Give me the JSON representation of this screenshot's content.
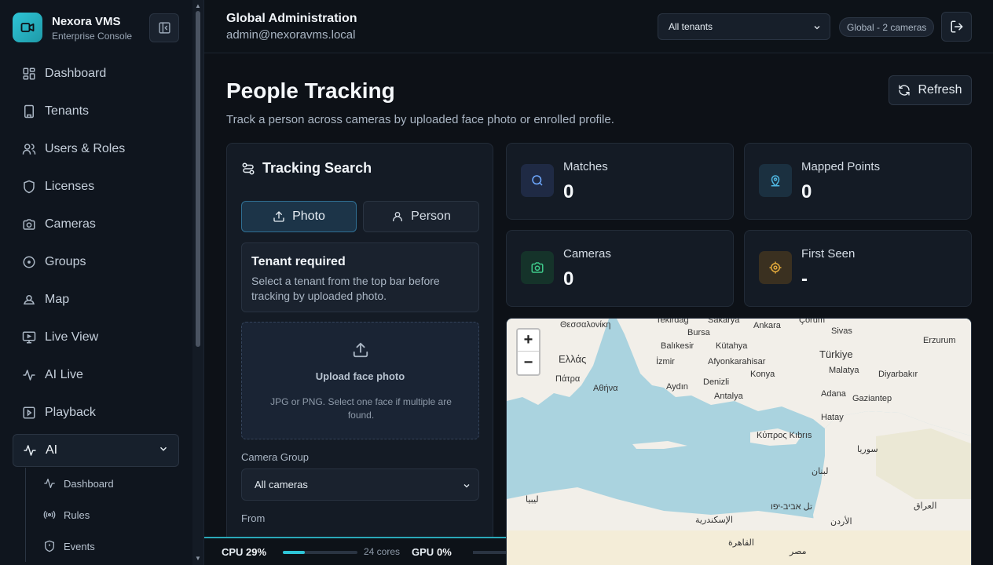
{
  "brand": {
    "title": "Nexora VMS",
    "subtitle": "Enterprise Console"
  },
  "nav": [
    {
      "label": "Dashboard",
      "icon": "dashboard-icon"
    },
    {
      "label": "Tenants",
      "icon": "building-icon"
    },
    {
      "label": "Users & Roles",
      "icon": "users-icon"
    },
    {
      "label": "Licenses",
      "icon": "shield-icon"
    },
    {
      "label": "Cameras",
      "icon": "camera-icon"
    },
    {
      "label": "Groups",
      "icon": "target-icon"
    },
    {
      "label": "Map",
      "icon": "map-pin-icon"
    },
    {
      "label": "Live View",
      "icon": "monitor-icon"
    },
    {
      "label": "AI Live",
      "icon": "pulse-icon"
    },
    {
      "label": "Playback",
      "icon": "play-icon"
    },
    {
      "label": "AI",
      "icon": "pulse-icon",
      "active": true
    }
  ],
  "subnav": [
    {
      "label": "Dashboard",
      "icon": "pulse-icon"
    },
    {
      "label": "Rules",
      "icon": "broadcast-icon"
    },
    {
      "label": "Events",
      "icon": "shield-icon"
    }
  ],
  "header": {
    "title": "Global Administration",
    "user": "admin@nexoravms.local",
    "tenant_select": "All tenants",
    "badge": "Global - 2 cameras"
  },
  "page": {
    "title": "People Tracking",
    "subtitle": "Track a person across cameras by uploaded face photo or enrolled profile.",
    "refresh_label": "Refresh"
  },
  "search": {
    "title": "Tracking Search",
    "tab_photo": "Photo",
    "tab_person": "Person",
    "notice_title": "Tenant required",
    "notice_text": "Select a tenant from the top bar before tracking by uploaded photo.",
    "upload_title": "Upload face photo",
    "upload_text": "JPG or PNG. Select one face if multiple are found.",
    "camera_group_label": "Camera Group",
    "camera_group_value": "All cameras",
    "from_label": "From"
  },
  "stats": [
    {
      "label": "Matches",
      "value": "0",
      "color": "#6ea8fe"
    },
    {
      "label": "Mapped Points",
      "value": "0",
      "color": "#4fb6e0"
    },
    {
      "label": "Cameras",
      "value": "0",
      "color": "#3ec98a"
    },
    {
      "label": "First Seen",
      "value": "-",
      "color": "#e2a93b"
    }
  ],
  "map": {
    "zoom_in": "+",
    "zoom_out": "−",
    "labels": [
      "Θεσσαλονίκη",
      "Tekirdağ",
      "Sakarya",
      "Ankara",
      "Çorum",
      "Sivas",
      "Erzurum",
      "Bursa",
      "Balıkesir",
      "Kütahya",
      "Ελλάς",
      "İzmir",
      "Afyonkarahisar",
      "Türkiye",
      "Malatya",
      "Diyarbakır",
      "Πάτρα",
      "Αθήνα",
      "Aydın",
      "Denizli",
      "Konya",
      "Antalya",
      "Adana",
      "Gaziantep",
      "Hatay",
      "Κύπρος Kıbrıs",
      "سوريا",
      "العراق",
      "لبنان",
      "ليبيا",
      "الإسكندرية",
      "القاهرة",
      "مصر",
      "الأردن",
      "تل אביב-יפו"
    ]
  },
  "system": {
    "cpu_label": "CPU",
    "cpu_value": "29%",
    "cpu_fraction": 0.29,
    "cores": "24 cores",
    "gpu_label": "GPU",
    "gpu_value": "0%"
  }
}
